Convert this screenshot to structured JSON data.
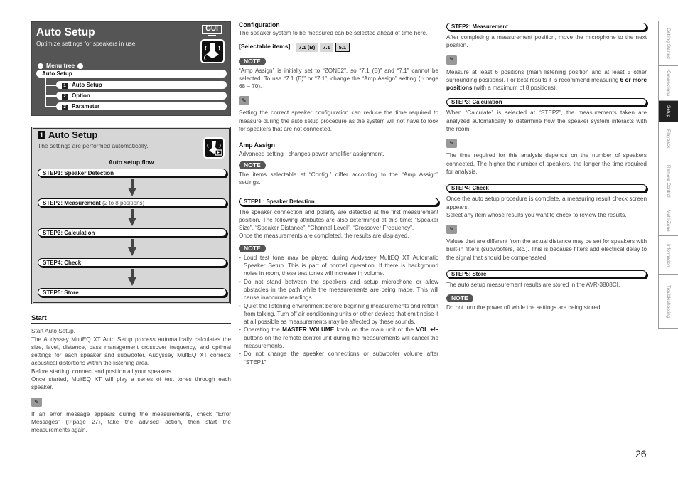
{
  "header": {
    "title": "Auto Setup",
    "subtitle": "Optimize settings for speakers in use.",
    "gui_badge": "GUI",
    "menu_tree_label": "Menu tree",
    "menu_root": "Auto Setup",
    "menu_items": [
      {
        "num": "1",
        "label": "Auto Setup"
      },
      {
        "num": "2",
        "label": "Option"
      },
      {
        "num": "3",
        "label": "Parameter"
      }
    ]
  },
  "auto_setup_box": {
    "num": "1",
    "title": "Auto Setup",
    "subtitle": "The settings are performed automatically.",
    "flow_title": "Auto setup flow",
    "steps": [
      {
        "label": "STEP1:  Speaker Detection",
        "detail": ""
      },
      {
        "label": "STEP2:  Measurement",
        "detail": " (2 to 8 positions)"
      },
      {
        "label": "STEP3:  Calculation",
        "detail": ""
      },
      {
        "label": "STEP4:  Check",
        "detail": ""
      },
      {
        "label": "STEP5:  Store",
        "detail": ""
      }
    ]
  },
  "start": {
    "heading": "Start",
    "lines": [
      "Start Auto Setup.",
      "The Audyssey MultEQ XT Auto Setup process automatically calculates the size, level, distance, bass management crossover frequency, and optimal settings for each speaker and subwoofer. Audyssey MultEQ XT corrects acoustical distortions within the listening area.",
      "Before starting, connect and position all your speakers.",
      "Once started, MultEQ XT will play a series of test tones through each speaker."
    ],
    "tip": "If an error message appears during the measurements, check “Error Messages” (☞page 27), take the advised action, then start the measurements again."
  },
  "configuration": {
    "heading": "Configuration",
    "text": "The speaker system to be measured can be selected ahead of time here.",
    "selectable_label": "[Selectable items]",
    "options": [
      "7.1 (B)",
      "7.1",
      "5.1"
    ],
    "selected": "5.1",
    "note_label": "NOTE",
    "note_text": "“Amp Assign” is initially set to “ZONE2”, so “7.1 (B)” and “7.1” cannot be selected. To use “7.1 (B)” or “7.1”, change the “Amp Assign” setting (☞page 68 – 70).",
    "tip": "Setting the correct speaker configuration can reduce the time required to measure during the auto setup procedure as the system will not have to look for speakers that are not connected."
  },
  "amp_assign": {
    "heading": "Amp Assign",
    "text": "Advanced setting : changes power amplifier assignment.",
    "note_label": "NOTE",
    "note_text": "The items selectable at “Config.” differ according to the “Amp Assign” settings."
  },
  "step1": {
    "heading": "STEP1 : Speaker Detection",
    "text1": "The speaker connection and polarity are detected at the first measurement position. The following attributes are also determined at this time: “Speaker Size”, “Speaker Distance”, “Channel Level”, “Crossover Frequency”.",
    "text2": "Once the measurements are completed, the results are displayed.",
    "note_label": "NOTE",
    "bullets": [
      "Loud test tone may be played during Audyssey MultEQ XT Automatic Speaker Setup. This is part of normal operation.  If there is background noise in room, these test tones will increase in volume.",
      "Do not stand between the speakers and setup microphone or allow obstacles in the path while the measurements are being made. This will cause inaccurate readings.",
      "Quiet the listening environment before beginning measurements and refrain from talking. Turn off air conditioning units or other devices that emit noise if at all possible as measurements may be affected by these sounds."
    ],
    "bullet4_pre": "Operating the ",
    "bullet4_b1": "MASTER VOLUME",
    "bullet4_mid": " knob on the main unit or the ",
    "bullet4_b2": "VOL +/–",
    "bullet4_post": " buttons on the remote control unit during the measurements will cancel the measurements.",
    "bullet5": "Do not change the speaker connections or subwoofer volume after “STEP1”."
  },
  "step2": {
    "heading": "STEP2: Measurement",
    "text": "After completing a measurement position, move the microphone to the next position.",
    "tip_pre": "Measure at least 6 positions (main listening position and at least 5 other surrounding positions). For best results it is recommend measuring ",
    "tip_bold": "6 or more positions",
    "tip_post": " (with a maximum of 8 positions)."
  },
  "step3": {
    "heading": "STEP3: Calculation",
    "text": "When “Calculate” is selected at “STEP2”, the measurements taken are analyzed automatically to determine how the speaker system interacts with the room.",
    "tip": "The time required for this analysis depends on the number of speakers connected. The higher the number of speakers, the longer the time required for analysis."
  },
  "step4": {
    "heading": "STEP4: Check",
    "text1": "Once the auto setup procedure is complete, a measuring result check screen appears.",
    "text2": "Select any item whose results you want to check to review the results.",
    "tip": "Values that are different from the actual distance may be set for speakers with built-in filters (subwoofers, etc.). This is because filters add electrical delay to the signal that should be compensated."
  },
  "step5": {
    "heading": "STEP5: Store",
    "text": "The auto setup measurement results are stored in the AVR-3808CI.",
    "note_label": "NOTE",
    "note_text": "Do not turn the power off while the settings are being stored."
  },
  "side_tabs": [
    {
      "label": "Getting Started",
      "active": false
    },
    {
      "label": "Connections",
      "active": false
    },
    {
      "label": "Setup",
      "active": true
    },
    {
      "label": "Playback",
      "active": false
    },
    {
      "label": "Remote Control",
      "active": false
    },
    {
      "label": "Multi-Zone",
      "active": false
    },
    {
      "label": "Information",
      "active": false
    },
    {
      "label": "Troubleshooting",
      "active": false
    }
  ],
  "page_number": "26",
  "icons": {
    "gui": "gui-monitor-icon",
    "auto_setup": "microphone-speaker-icon",
    "tip": "pencil-icon",
    "page_ref": "pointing-hand-icon"
  }
}
